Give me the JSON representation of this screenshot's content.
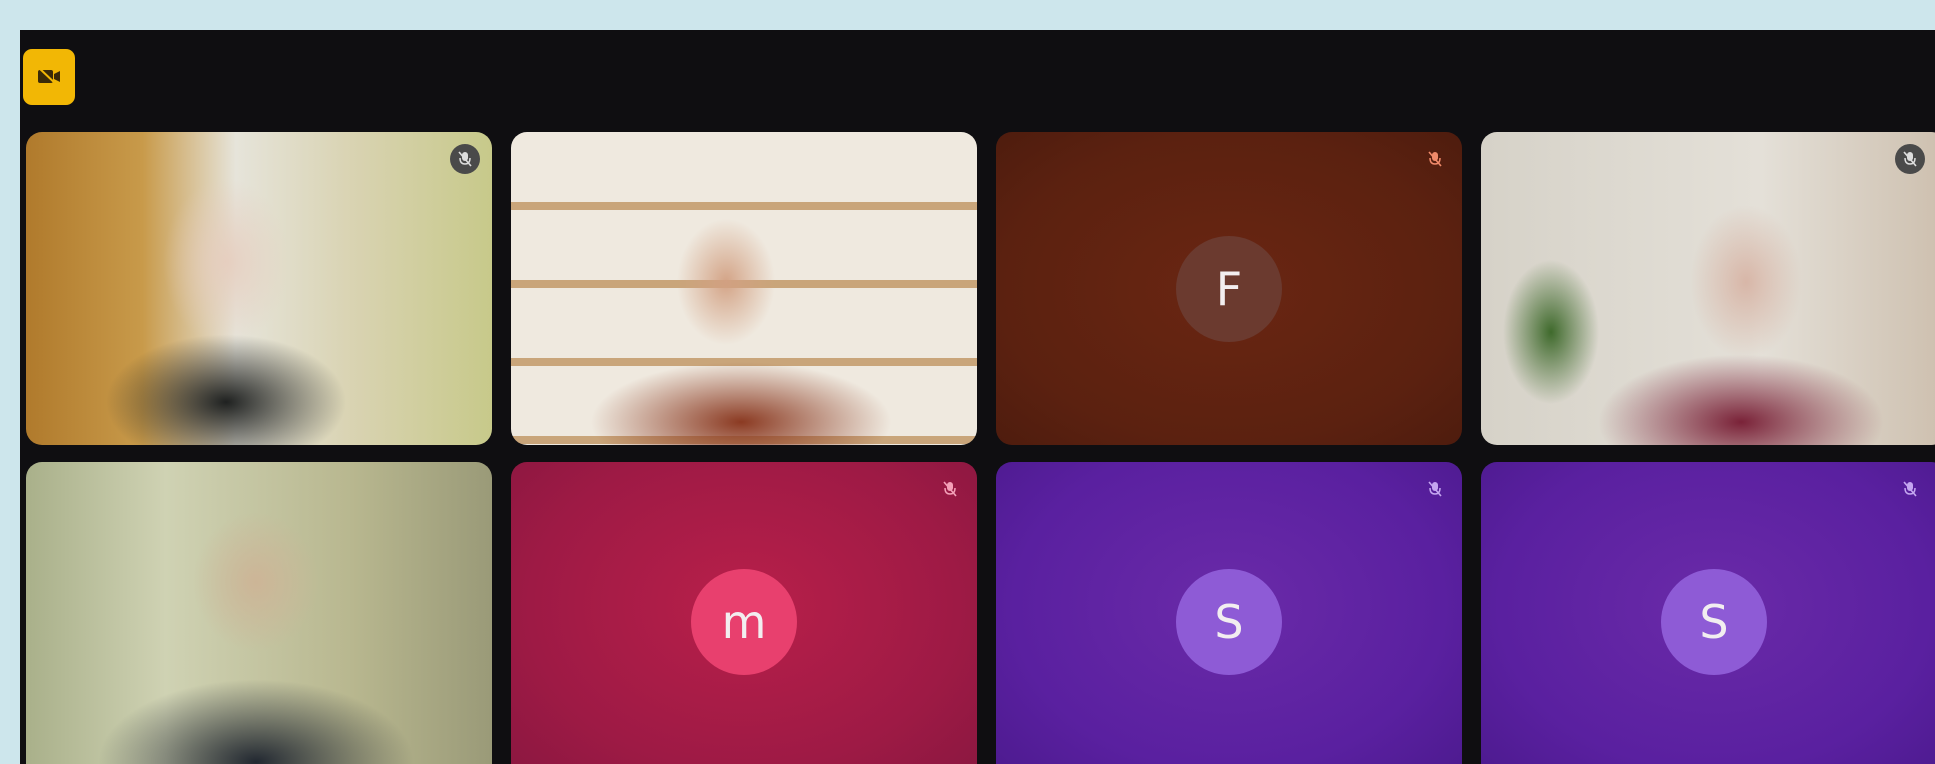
{
  "toolbar": {
    "camera_icon": "video-camera-icon",
    "accent_color": "#f2b705"
  },
  "participants": [
    {
      "id": "p1",
      "type": "video",
      "mic": "muted",
      "initial": ""
    },
    {
      "id": "p2",
      "type": "video",
      "mic": "active",
      "initial": ""
    },
    {
      "id": "p3",
      "type": "avatar",
      "mic": "muted",
      "initial": "F",
      "avatar_color": "#6b3a2f",
      "tile_color": "#5b2110"
    },
    {
      "id": "p4",
      "type": "video",
      "mic": "muted",
      "initial": ""
    },
    {
      "id": "p5",
      "type": "video",
      "mic": "active",
      "initial": ""
    },
    {
      "id": "p6",
      "type": "avatar",
      "mic": "muted",
      "initial": "m",
      "avatar_color": "#e8406e",
      "tile_color": "#9e1a45"
    },
    {
      "id": "p7",
      "type": "avatar",
      "mic": "muted",
      "initial": "S",
      "avatar_color": "#8e5bd6",
      "tile_color": "#5a20a0"
    },
    {
      "id": "p8",
      "type": "avatar",
      "mic": "muted",
      "initial": "S",
      "avatar_color": "#8e5bd6",
      "tile_color": "#5a20a0"
    }
  ]
}
